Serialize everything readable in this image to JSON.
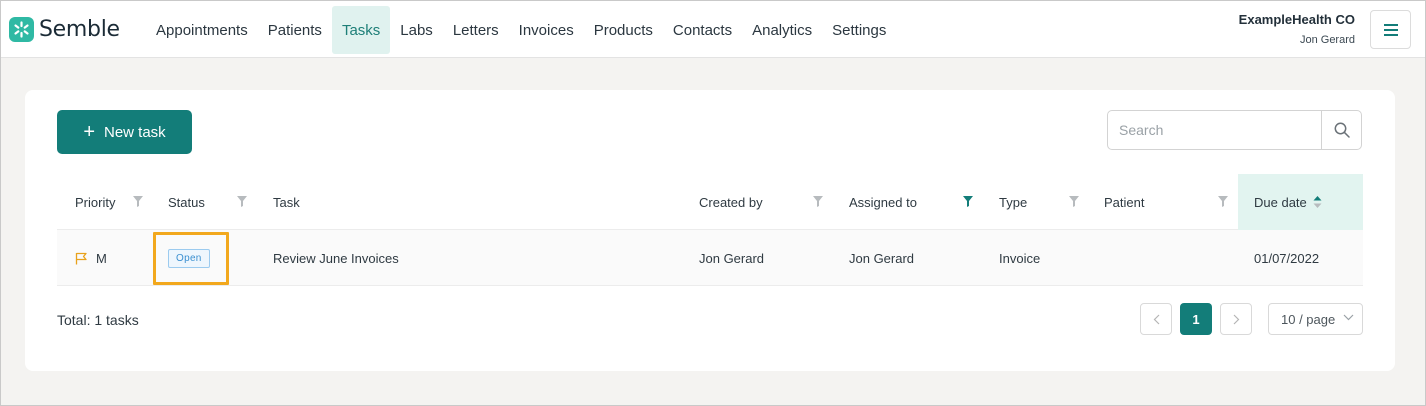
{
  "app": {
    "name": "Semble"
  },
  "nav": {
    "items": [
      {
        "label": "Appointments",
        "active": false
      },
      {
        "label": "Patients",
        "active": false
      },
      {
        "label": "Tasks",
        "active": true
      },
      {
        "label": "Labs",
        "active": false
      },
      {
        "label": "Letters",
        "active": false
      },
      {
        "label": "Invoices",
        "active": false
      },
      {
        "label": "Products",
        "active": false
      },
      {
        "label": "Contacts",
        "active": false
      },
      {
        "label": "Analytics",
        "active": false
      },
      {
        "label": "Settings",
        "active": false
      }
    ]
  },
  "account": {
    "org": "ExampleHealth CO",
    "user": "Jon Gerard"
  },
  "toolbar": {
    "new_task_label": "New task",
    "search_placeholder": "Search"
  },
  "table": {
    "columns": [
      "Priority",
      "Status",
      "Task",
      "Created by",
      "Assigned to",
      "Type",
      "Patient",
      "Due date"
    ],
    "active_filter_column": "Assigned to",
    "sorted_column": "Due date",
    "sort_direction": "ascending",
    "rows": [
      {
        "priority": "M",
        "status": "Open",
        "task": "Review June Invoices",
        "created_by": "Jon Gerard",
        "assigned_to": "Jon Gerard",
        "type": "Invoice",
        "patient": "",
        "due_date": "01/07/2022"
      }
    ]
  },
  "footer": {
    "total_text": "Total: 1 tasks",
    "current_page": "1",
    "page_size": "10 / page"
  },
  "colors": {
    "brand": "#137d79",
    "logo": "#2fb9a4",
    "active_tab_bg": "#e0f2ef",
    "highlight": "#f2a81d",
    "badge_text": "#3a8fd0",
    "priority_flag": "#e8a21c"
  }
}
